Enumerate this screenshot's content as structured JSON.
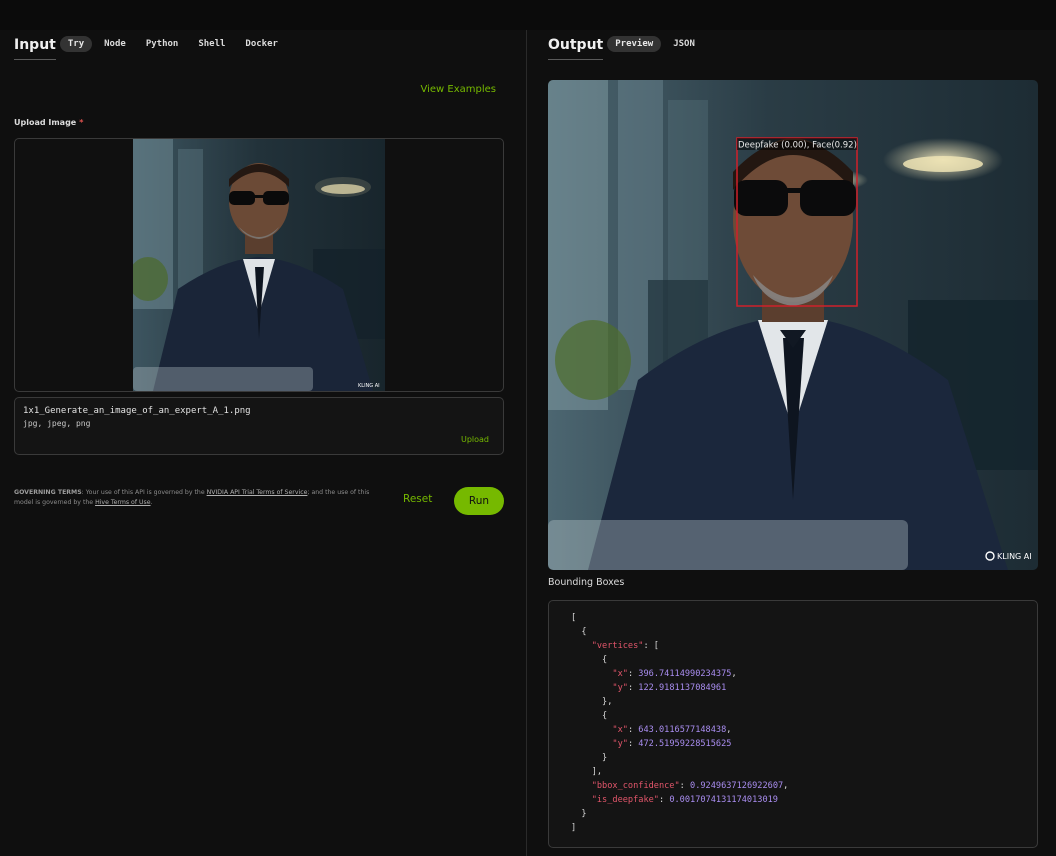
{
  "input": {
    "title": "Input",
    "tabs": [
      {
        "label": "Try",
        "active": true
      },
      {
        "label": "Node",
        "active": false
      },
      {
        "label": "Python",
        "active": false
      },
      {
        "label": "Shell",
        "active": false
      },
      {
        "label": "Docker",
        "active": false
      }
    ],
    "view_examples": "View Examples",
    "upload_label": "Upload Image",
    "required_mark": "*",
    "file_name": "1x1_Generate_an_image_of_an_expert_A_1.png",
    "file_types": "jpg, jpeg, png",
    "upload_button": "Upload",
    "terms": {
      "heading": "GOVERNING TERMS",
      "text1": ": Your use of this API is governed by the ",
      "link1": "NVIDIA API Trial Terms of Service",
      "text2": "; and the use of this model is governed by the ",
      "link2": "Hive Terms of Use",
      "text3": "."
    },
    "reset_button": "Reset",
    "run_button": "Run",
    "watermark_small": "KLING AI"
  },
  "output": {
    "title": "Output",
    "tabs": [
      {
        "label": "Preview",
        "active": true
      },
      {
        "label": "JSON",
        "active": false
      }
    ],
    "box_label": "Deepfake (0.00), Face(0.92)",
    "watermark": "KLING AI",
    "bounding_boxes_label": "Bounding Boxes",
    "json": {
      "vertices_key": "\"vertices\"",
      "x1": "396.74114990234375",
      "y1": "122.9181137084961",
      "x2": "643.0116577148438",
      "y2": "472.51959228515625",
      "x_key": "\"x\"",
      "y_key": "\"y\"",
      "bbox_key": "\"bbox_confidence\"",
      "bbox_confidence": "0.9249637126922607",
      "deepfake_key": "\"is_deepfake\"",
      "is_deepfake": "0.0017074131174013019"
    }
  },
  "colors": {
    "accent": "#76b900",
    "box": "#d0202a",
    "json_key": "#e3566b",
    "json_number": "#a98df0"
  }
}
